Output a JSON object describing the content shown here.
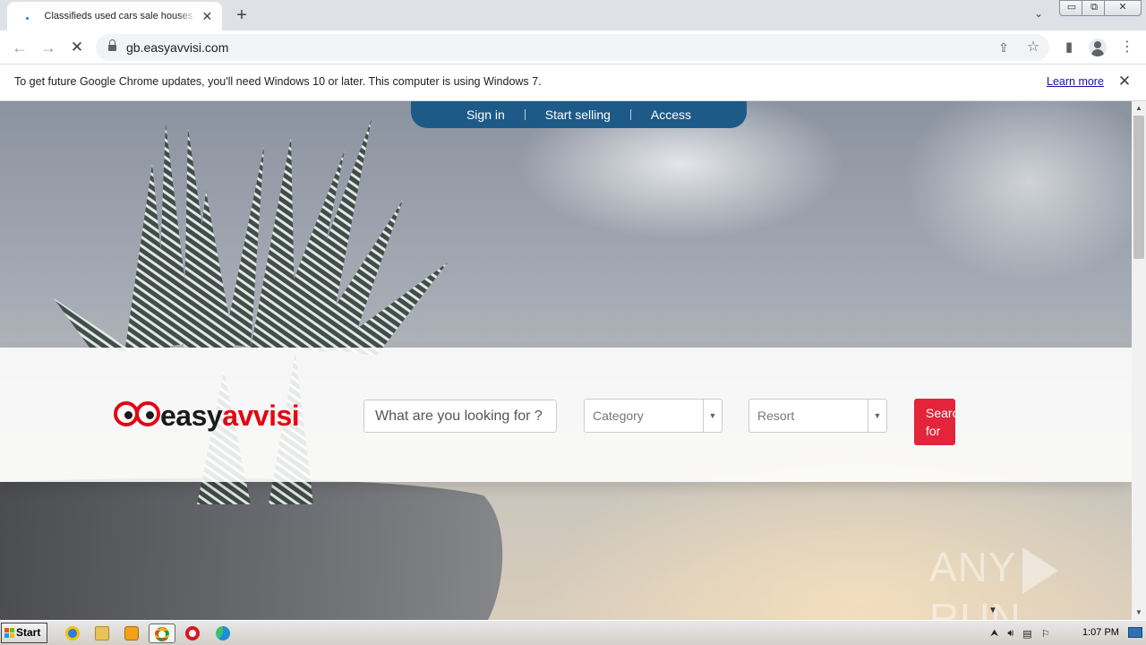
{
  "browser": {
    "tab": {
      "title": "Classifieds used cars sale houses rent",
      "close": "✕"
    },
    "new_tab": "+",
    "tab_search": "⌄",
    "window_controls": {
      "minimize": "▭",
      "restore": "⧉",
      "close": "✕"
    },
    "nav": {
      "back": "←",
      "forward": "→",
      "reload": "✕"
    },
    "url": "gb.easyavvisi.com",
    "omnibox_icons": {
      "share": "⇪",
      "bookmark": "☆"
    },
    "toolbar_icons": {
      "side_panel": "▮",
      "menu": "⋮"
    }
  },
  "infobar": {
    "message": "To get future Google Chrome updates, you'll need Windows 10 or later. This computer is using Windows 7.",
    "link": "Learn more",
    "close": "✕"
  },
  "site": {
    "topnav": [
      "Sign in",
      "Start selling",
      "Access"
    ],
    "logo": {
      "part1": "easy",
      "part2": "avvisi"
    },
    "search": {
      "value": "What are you looking for ? -",
      "category": "Category",
      "resort": "Resort",
      "select_arrow": "▼",
      "button": "Search for"
    },
    "watermark": {
      "left": "ANY",
      "right": "RUN"
    },
    "scroll_marker": "▼"
  },
  "scrollbar": {
    "up": "▲",
    "down": "▼"
  },
  "taskbar": {
    "start": "Start",
    "clock": "1:07 PM",
    "tray_icons": [
      "up-arrow-icon",
      "speaker-icon",
      "network-icon",
      "flag-icon"
    ],
    "tray_up": "⮝"
  },
  "colors": {
    "nav_blue": "#1d5a87",
    "brand_red": "#e30613",
    "search_button": "#e3243b",
    "link": "#1a0dab"
  }
}
